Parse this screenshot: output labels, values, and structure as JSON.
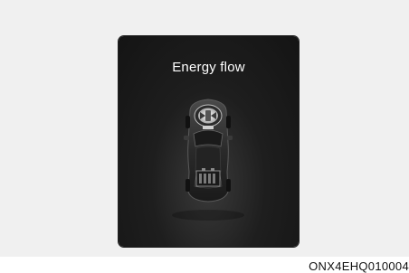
{
  "display": {
    "title": "Energy flow",
    "icons": [
      "car-top-view-icon",
      "engine-icon",
      "battery-icon"
    ]
  },
  "caption": "ONX4EHQ010004"
}
